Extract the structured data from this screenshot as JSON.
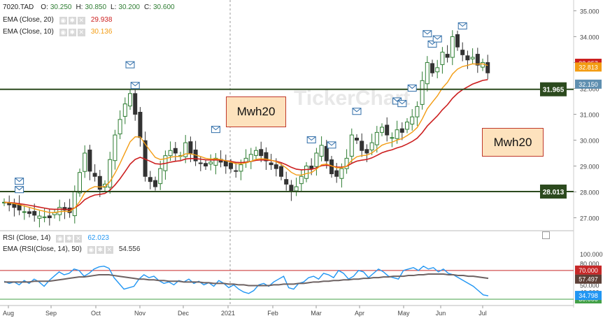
{
  "symbol": "7020.TAD",
  "ohlc": {
    "o_label": "O:",
    "o": "30.250",
    "h_label": "H:",
    "h": "30.850",
    "l_label": "L:",
    "l": "30.200",
    "c_label": "C:",
    "c": "30.600"
  },
  "indicators": {
    "ema20": {
      "label": "EMA  (Close, 20)",
      "value": "29.938",
      "color": "#cc1f1f"
    },
    "ema10": {
      "label": "EMA  (Close, 10)",
      "value": "30.136",
      "color": "#f39c12"
    },
    "rsi": {
      "label": "RSI  (Close, 14)",
      "value": "62.023",
      "color": "#2196f3"
    },
    "rsi_ema": {
      "label": "EMA  (RSI(Close, 14), 50)",
      "value": "54.556",
      "color": "#6d4c41"
    }
  },
  "icons": [
    "eye-icon",
    "gear-icon",
    "close-icon"
  ],
  "watermark": "TickerChart",
  "annotations": [
    {
      "text": "Mwh20"
    },
    {
      "text": "Mwh20"
    }
  ],
  "chart_data": [
    {
      "type": "candlestick",
      "title": "",
      "x_ticks": [
        "Aug",
        "Sep",
        "Oct",
        "Nov",
        "Dec",
        "2021",
        "Feb",
        "Mar",
        "Apr",
        "May",
        "Jun",
        "Jul"
      ],
      "y_ticks": [
        "27.000",
        "28.000",
        "29.000",
        "30.000",
        "31.000",
        "32.000",
        "33.000",
        "34.000",
        "35.000"
      ],
      "ylim": [
        26.5,
        35.2
      ],
      "horizontal_lines": [
        {
          "value": 31.965,
          "label": "31.965"
        },
        {
          "value": 28.013,
          "label": "28.013"
        }
      ],
      "price_labels": [
        {
          "value": 32.957,
          "label": "32.957",
          "color": "#cc1f1f"
        },
        {
          "value": 32.813,
          "label": "32.813",
          "color": "#f39c12"
        },
        {
          "value": 32.15,
          "label": "32.150",
          "color": "#5f8fb0"
        }
      ],
      "close_points": [
        [
          0,
          27.6
        ],
        [
          3,
          27.3
        ],
        [
          6,
          27.1
        ],
        [
          9,
          27.0
        ],
        [
          11,
          27.4
        ],
        [
          13,
          27.2
        ],
        [
          14,
          28.0
        ],
        [
          16,
          29.5
        ],
        [
          17,
          28.8
        ],
        [
          18,
          28.6
        ],
        [
          19,
          28.1
        ],
        [
          20,
          28.3
        ],
        [
          22,
          30.2
        ],
        [
          23,
          30.8
        ],
        [
          24,
          31.4
        ],
        [
          25,
          31.8
        ],
        [
          25.3,
          32.1
        ],
        [
          26,
          31.0
        ],
        [
          27,
          30.1
        ],
        [
          28,
          28.6
        ],
        [
          29,
          28.4
        ],
        [
          30,
          28.2
        ],
        [
          31,
          28.9
        ],
        [
          32,
          29.4
        ],
        [
          33,
          29.6
        ],
        [
          35,
          29.4
        ],
        [
          36,
          29.9
        ],
        [
          37,
          29.5
        ],
        [
          38,
          29.2
        ],
        [
          40,
          29.0
        ],
        [
          42,
          29.3
        ],
        [
          44,
          29.0
        ],
        [
          46,
          28.8
        ],
        [
          48,
          29.3
        ],
        [
          50,
          29.6
        ],
        [
          52,
          29.2
        ],
        [
          54,
          28.9
        ],
        [
          56,
          28.3
        ],
        [
          57,
          28.0
        ],
        [
          58,
          28.2
        ],
        [
          59,
          28.6
        ],
        [
          60,
          29.0
        ],
        [
          61,
          28.9
        ],
        [
          62,
          29.5
        ],
        [
          63,
          29.8
        ],
        [
          64,
          29.2
        ],
        [
          65,
          28.7
        ],
        [
          66,
          28.6
        ],
        [
          67,
          28.9
        ],
        [
          68,
          29.3
        ],
        [
          69,
          30.2
        ],
        [
          70,
          30.0
        ],
        [
          71,
          29.6
        ],
        [
          72,
          29.5
        ],
        [
          73,
          29.9
        ],
        [
          74,
          30.3
        ],
        [
          75,
          30.5
        ],
        [
          76,
          30.2
        ],
        [
          77,
          30.1
        ],
        [
          78,
          30.4
        ],
        [
          79,
          30.3
        ],
        [
          80,
          30.7
        ],
        [
          81,
          30.9
        ],
        [
          82,
          31.3
        ],
        [
          83,
          32.3
        ],
        [
          84,
          33.0
        ],
        [
          85,
          32.6
        ],
        [
          86,
          32.8
        ],
        [
          87,
          33.4
        ],
        [
          88,
          33.2
        ],
        [
          89,
          34.0
        ],
        [
          89.5,
          34.1
        ],
        [
          90,
          33.6
        ],
        [
          91,
          33.3
        ],
        [
          92,
          33.1
        ],
        [
          93,
          33.2
        ],
        [
          94,
          32.9
        ],
        [
          95,
          33.0
        ],
        [
          96,
          32.6
        ],
        [
          96.5,
          32.15
        ]
      ],
      "alert_markers_count": 15
    },
    {
      "type": "line",
      "title": "",
      "y_ticks": [
        "30.000",
        "40.000",
        "50.000",
        "60.000",
        "70.000",
        "80.000",
        "100.000"
      ],
      "ylim": [
        30,
        100
      ],
      "reference_lines": [
        {
          "value": 70,
          "label": "70.000",
          "color": "#c62828"
        },
        {
          "value": 30,
          "label": "30.000",
          "color": "#43a047"
        }
      ],
      "value_labels": [
        {
          "value": 57.497,
          "label": "57.497",
          "color": "#5d4037"
        },
        {
          "value": 34.798,
          "label": "34.798",
          "color": "#2196f3"
        }
      ],
      "series": [
        {
          "values": [
            55,
            52,
            54,
            50,
            56,
            52,
            58,
            54,
            48,
            56,
            62,
            68,
            64,
            66,
            72,
            70,
            62,
            66,
            72,
            75,
            76,
            73,
            60,
            52,
            44,
            46,
            48,
            58,
            64,
            60,
            62,
            56,
            52,
            54,
            50,
            56,
            54,
            58,
            52,
            55,
            50,
            53,
            48,
            56,
            52,
            46,
            50,
            44,
            40,
            38,
            42,
            50,
            52,
            48,
            54,
            58,
            62,
            46,
            44,
            52,
            54,
            60,
            62,
            58,
            66,
            64,
            60,
            70,
            66,
            58,
            62,
            70,
            68,
            60,
            66,
            72,
            68,
            62,
            60,
            58,
            70,
            72,
            74,
            70,
            76,
            72,
            74,
            68,
            72,
            66,
            64,
            60,
            56,
            52,
            48,
            42,
            36,
            34.8
          ]
        },
        {
          "values": [
            54,
            54,
            54,
            54,
            54,
            54,
            55,
            55,
            55,
            55,
            56,
            57,
            58,
            59,
            60,
            61,
            61,
            62,
            63,
            64,
            64,
            64,
            63,
            62,
            61,
            60,
            59,
            58,
            58,
            57,
            57,
            56,
            56,
            55,
            55,
            55,
            54,
            54,
            54,
            54,
            53,
            53,
            52,
            52,
            52,
            51,
            51,
            50,
            50,
            49,
            49,
            49,
            49,
            49,
            50,
            50,
            51,
            51,
            51,
            52,
            52,
            53,
            54,
            54,
            55,
            55,
            56,
            56,
            57,
            57,
            58,
            58,
            59,
            59,
            60,
            60,
            61,
            61,
            62,
            62,
            62,
            63,
            63,
            64,
            64,
            65,
            65,
            65,
            65,
            64,
            64,
            63,
            63,
            62,
            62,
            61,
            60,
            59
          ]
        }
      ]
    }
  ]
}
